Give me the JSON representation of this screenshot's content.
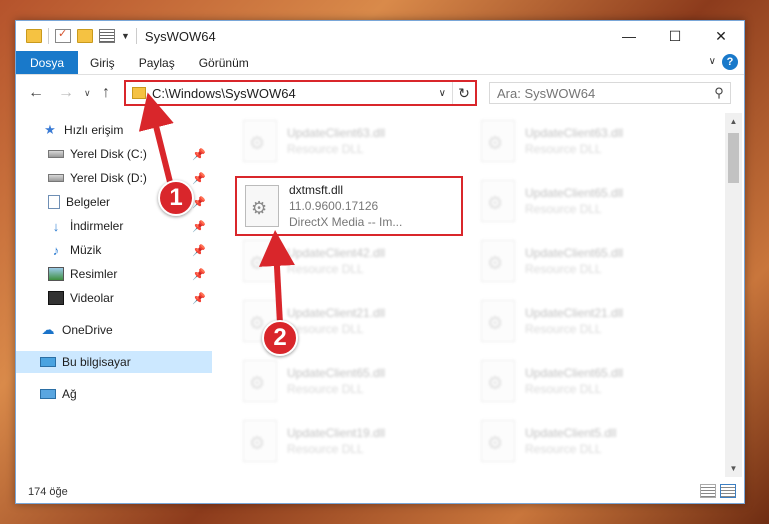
{
  "window": {
    "title": "SysWOW64",
    "controls": {
      "minimize": "—",
      "maximize": "☐",
      "close": "✕"
    }
  },
  "ribbon": {
    "tabs": [
      "Dosya",
      "Giriş",
      "Paylaş",
      "Görünüm"
    ],
    "expand_icon": "chevron-down-icon",
    "help_label": "?"
  },
  "addressbar": {
    "path": "C:\\Windows\\SysWOW64",
    "refresh_icon": "refresh-icon"
  },
  "search": {
    "placeholder": "Ara: SysWOW64"
  },
  "sidebar": {
    "items": [
      {
        "label": "Hızlı erişim",
        "icon": "star-icon",
        "pinned": false
      },
      {
        "label": "Yerel Disk (C:)",
        "icon": "drive-icon",
        "pinned": true
      },
      {
        "label": "Yerel Disk (D:)",
        "icon": "drive-icon",
        "pinned": true
      },
      {
        "label": "Belgeler",
        "icon": "document-icon",
        "pinned": true
      },
      {
        "label": "İndirmeler",
        "icon": "download-icon",
        "pinned": true
      },
      {
        "label": "Müzik",
        "icon": "music-icon",
        "pinned": true
      },
      {
        "label": "Resimler",
        "icon": "pictures-icon",
        "pinned": true
      },
      {
        "label": "Videolar",
        "icon": "video-icon",
        "pinned": true
      },
      {
        "label": "OneDrive",
        "icon": "cloud-icon",
        "pinned": false
      },
      {
        "label": "Bu bilgisayar",
        "icon": "computer-icon",
        "pinned": false,
        "selected": true
      },
      {
        "label": "Ağ",
        "icon": "network-icon",
        "pinned": false
      }
    ]
  },
  "files": {
    "highlighted": {
      "name": "dxtmsft.dll",
      "version": "11.0.9600.17126",
      "description": "DirectX Media -- Im..."
    },
    "left_column": [
      {
        "name": "UpdateClient63.dll",
        "type": "Resource DLL"
      },
      {
        "name": "UpdateClient42.dll",
        "type": "Resource DLL"
      },
      {
        "name": "UpdateClient21.dll",
        "type": "Resource DLL"
      },
      {
        "name": "UpdateClient65.dll",
        "type": "Resource DLL"
      },
      {
        "name": "UpdateClient19.dll",
        "type": "Resource DLL"
      }
    ],
    "right_column": [
      {
        "name": "UpdateClient63.dll",
        "type": "Resource DLL"
      },
      {
        "name": "UpdateClient65.dll",
        "type": "Resource DLL"
      },
      {
        "name": "UpdateClient65.dll",
        "type": "Resource DLL"
      },
      {
        "name": "UpdateClient21.dll",
        "type": "Resource DLL"
      },
      {
        "name": "UpdateClient65.dll",
        "type": "Resource DLL"
      },
      {
        "name": "UpdateClient5.dll",
        "type": "Resource DLL"
      }
    ]
  },
  "status": {
    "item_count": "174 öğe"
  },
  "annotations": {
    "step1": "1",
    "step2": "2",
    "color": "#d9262b"
  }
}
